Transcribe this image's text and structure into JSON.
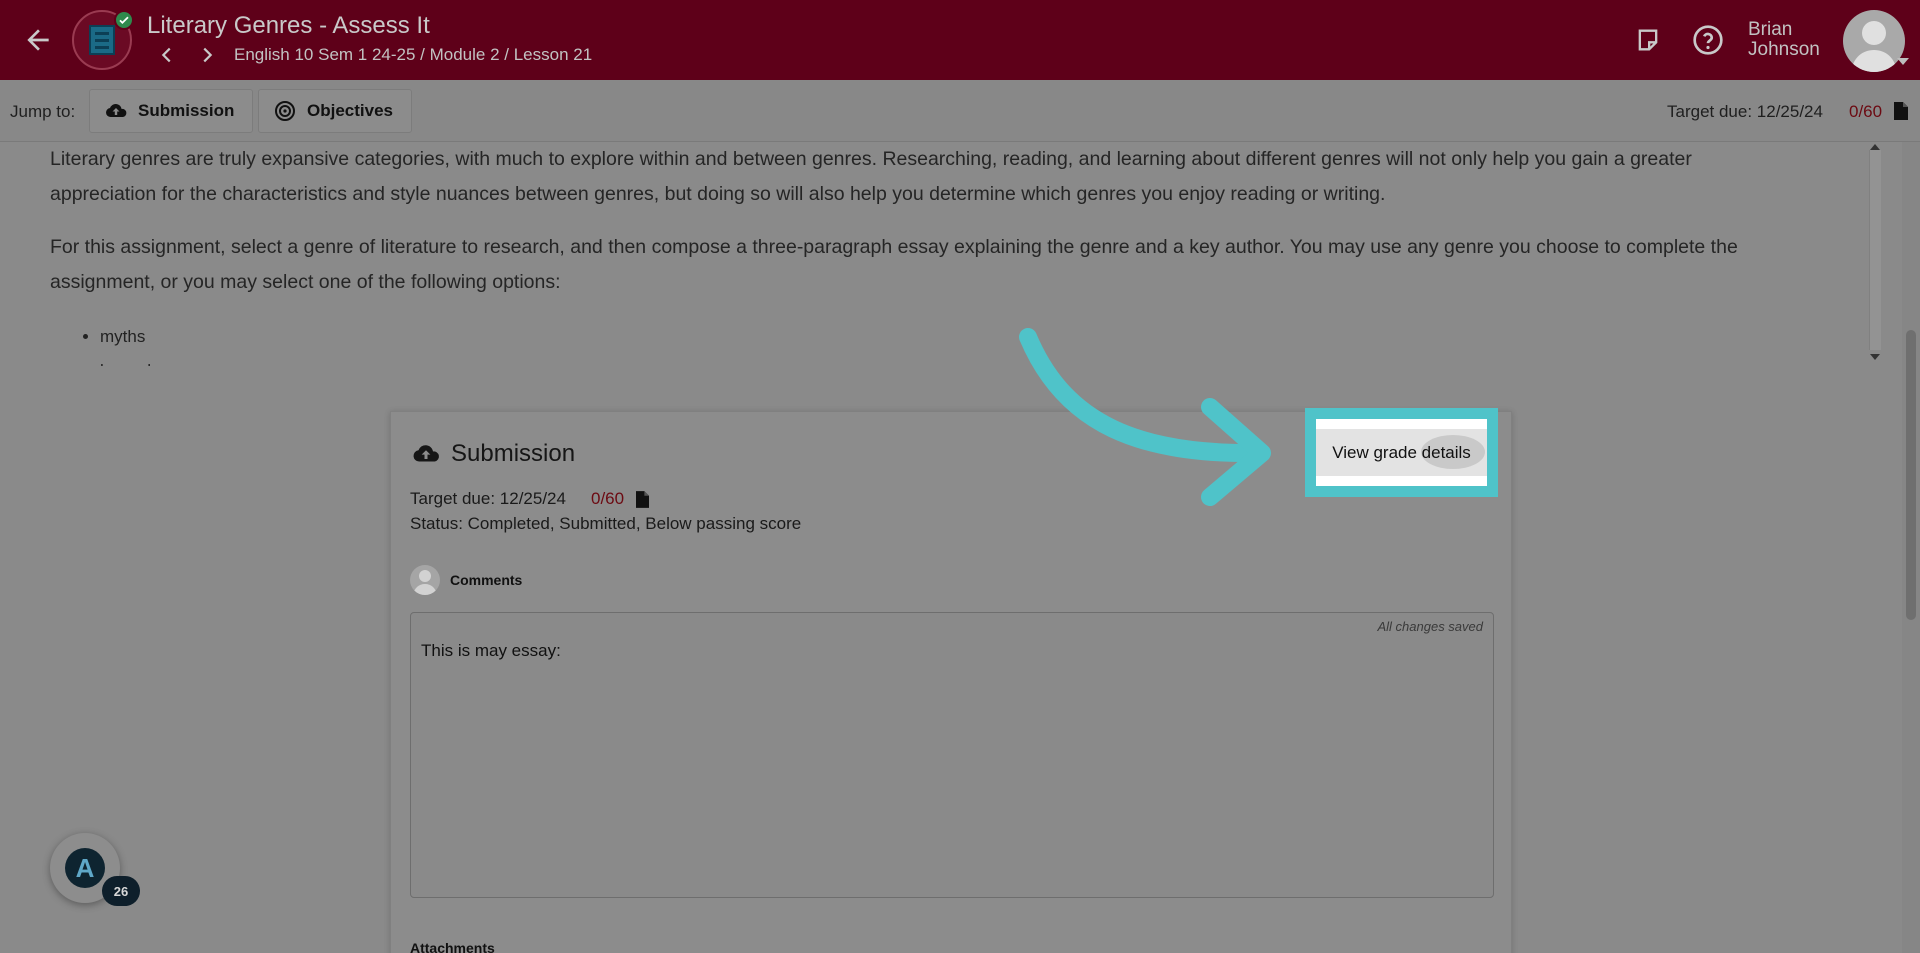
{
  "header": {
    "title": "Literary Genres - Assess It",
    "breadcrumb": "English 10 Sem 1 24-25 / Module 2 / Lesson 21",
    "user": {
      "first_name": "Brian",
      "last_name": "Johnson"
    },
    "background_color": "#5e0019"
  },
  "jumpbar": {
    "label": "Jump to:",
    "buttons": [
      {
        "label": "Submission",
        "icon": "cloud-upload-icon"
      },
      {
        "label": "Objectives",
        "icon": "target-icon"
      }
    ],
    "target_due": "Target due: 12/25/24",
    "score": "0/60"
  },
  "instructions": {
    "paragraph_1": "Literary genres are truly expansive categories, with much to explore within and between genres. Researching, reading, and learning about different genres will not only help you gain a greater appreciation for the characteristics and style nuances between genres, but doing so will also help you determine which genres you enjoy reading or writing.",
    "paragraph_2": "For this assignment, select a genre of literature to research, and then compose a three-paragraph essay explaining the genre and a key author. You may use any genre you choose to complete the assignment, or you may select one of the following options:",
    "options": [
      "myths",
      "legends"
    ]
  },
  "submission": {
    "title": "Submission",
    "target_due": "Target due: 12/25/24",
    "score": "0/60",
    "status": "Status: Completed, Submitted, Below passing score",
    "comments_label": "Comments",
    "saved_note": "All changes saved",
    "essay_text": "This is may essay:",
    "attachments_label": "Attachments",
    "grade_button_label": "View grade details"
  },
  "floating_badge": {
    "count": "26",
    "logo_letter": "A"
  },
  "colors": {
    "accent_highlight": "#4fc3c9",
    "score_red": "#6c0a12"
  }
}
